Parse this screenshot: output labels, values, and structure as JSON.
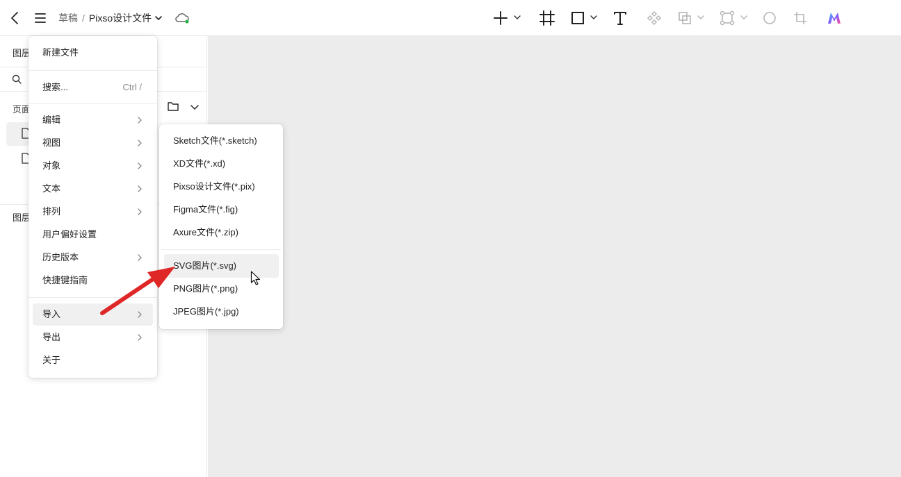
{
  "topbar": {
    "breadcrumb_root": "草稿",
    "breadcrumb_sep": "/",
    "file_name": "Pixso设计文件"
  },
  "left_panel": {
    "tab_layers": "图层",
    "pages_label": "页面",
    "layers_label": "图层"
  },
  "main_menu": {
    "new_file": "新建文件",
    "search": "搜索...",
    "search_shortcut": "Ctrl  /",
    "edit": "编辑",
    "view": "视图",
    "object": "对象",
    "text": "文本",
    "arrange": "排列",
    "preferences": "用户偏好设置",
    "history": "历史版本",
    "shortcuts": "快捷键指南",
    "import": "导入",
    "export": "导出",
    "about": "关于"
  },
  "import_submenu": {
    "sketch": "Sketch文件(*.sketch)",
    "xd": "XD文件(*.xd)",
    "pix": "Pixso设计文件(*.pix)",
    "figma": "Figma文件(*.fig)",
    "axure": "Axure文件(*.zip)",
    "svg": "SVG图片(*.svg)",
    "png": "PNG图片(*.png)",
    "jpeg": "JPEG图片(*.jpg)"
  },
  "colors": {
    "accent_green": "#2bb24c",
    "arrow_red": "#e02727",
    "canvas_bg": "#ececec"
  },
  "icons": [
    "back-arrow-icon",
    "hamburger-menu-icon",
    "chevron-down-icon",
    "cloud-sync-icon",
    "plus-icon",
    "frame-icon",
    "rectangle-icon",
    "text-tool-icon",
    "component-icon",
    "boolean-icon",
    "auto-layout-icon",
    "ellipse-icon",
    "crop-icon",
    "ai-logo-icon",
    "search-icon",
    "folder-icon",
    "page-icon",
    "chevron-right-icon",
    "mouse-cursor-icon"
  ]
}
